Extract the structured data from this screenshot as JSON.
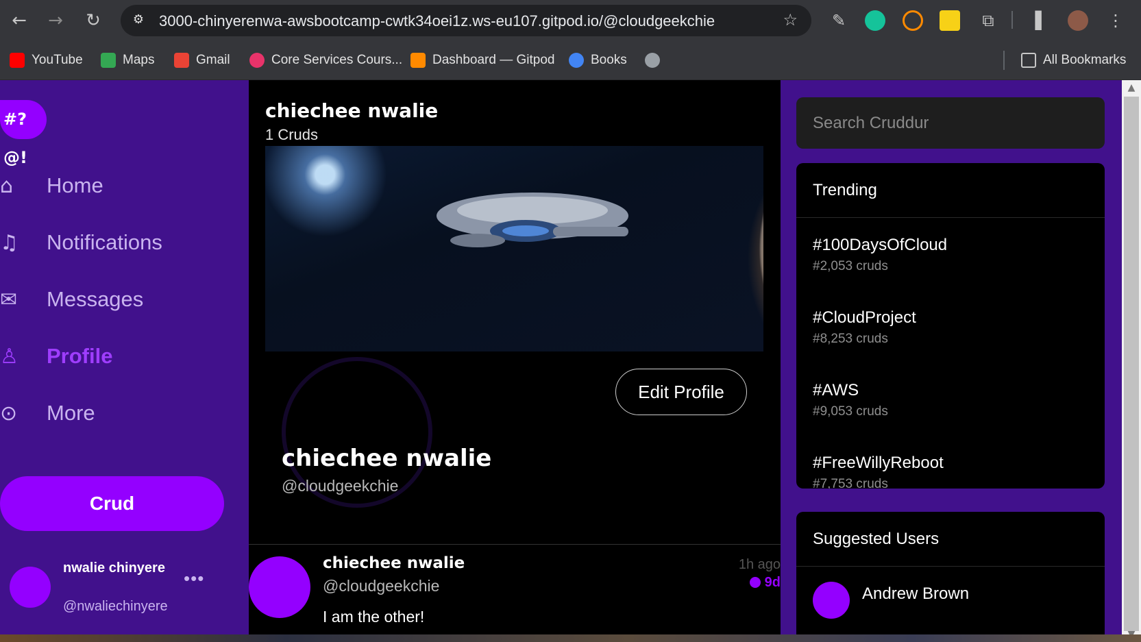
{
  "browser": {
    "url": "3000-chinyerenwa-awsbootcamp-cwtk34oei1z.ws-eu107.gitpod.io/@cloudgeekchie",
    "bookmarks": [
      {
        "label": "YouTube",
        "icon": "youtube-icon",
        "color": "#ff0000"
      },
      {
        "label": "Maps",
        "icon": "maps-icon",
        "color": "#34a853"
      },
      {
        "label": "Gmail",
        "icon": "gmail-icon",
        "color": "#ea4335"
      },
      {
        "label": "Core Services Cours...",
        "icon": "core-services-icon",
        "color": "#e8336a"
      },
      {
        "label": "Dashboard — Gitpod",
        "icon": "gitpod-icon",
        "color": "#ff8a00"
      },
      {
        "label": "Books",
        "icon": "google-icon",
        "color": "#4285f4"
      }
    ],
    "all_bookmarks_label": "All Bookmarks"
  },
  "sidebar": {
    "logo_text": "#?@!",
    "nav": [
      {
        "label": "Home",
        "icon": "home-icon"
      },
      {
        "label": "Notifications",
        "icon": "bell-icon"
      },
      {
        "label": "Messages",
        "icon": "mail-icon"
      },
      {
        "label": "Profile",
        "icon": "profile-icon",
        "active": true
      },
      {
        "label": "More",
        "icon": "more-icon"
      }
    ],
    "crud_button": "Crud",
    "current_user": {
      "display_name": "nwalie chinyere",
      "handle": "@nwaliechinyere"
    }
  },
  "profile": {
    "display_name": "chiechee nwalie",
    "crud_count": "1 Cruds",
    "edit_button": "Edit Profile",
    "handle": "@cloudgeekchie"
  },
  "feed": [
    {
      "display_name": "chiechee nwalie",
      "handle": "@cloudgeekchie",
      "message": "I am the other!",
      "time_ago": "1h ago",
      "expires": "9d"
    }
  ],
  "right": {
    "search_placeholder": "Search Cruddur",
    "trending_title": "Trending",
    "trending": [
      {
        "tag": "#100DaysOfCloud",
        "count": "#2,053 cruds"
      },
      {
        "tag": "#CloudProject",
        "count": "#8,253 cruds"
      },
      {
        "tag": "#AWS",
        "count": "#9,053 cruds"
      },
      {
        "tag": "#FreeWillyReboot",
        "count": "#7,753 cruds"
      }
    ],
    "suggested_title": "Suggested Users",
    "suggested": [
      {
        "name": "Andrew Brown"
      }
    ]
  },
  "colors": {
    "accent": "#9400ff",
    "sidebar_bg": "#41118c",
    "main_bg": "#000000"
  }
}
